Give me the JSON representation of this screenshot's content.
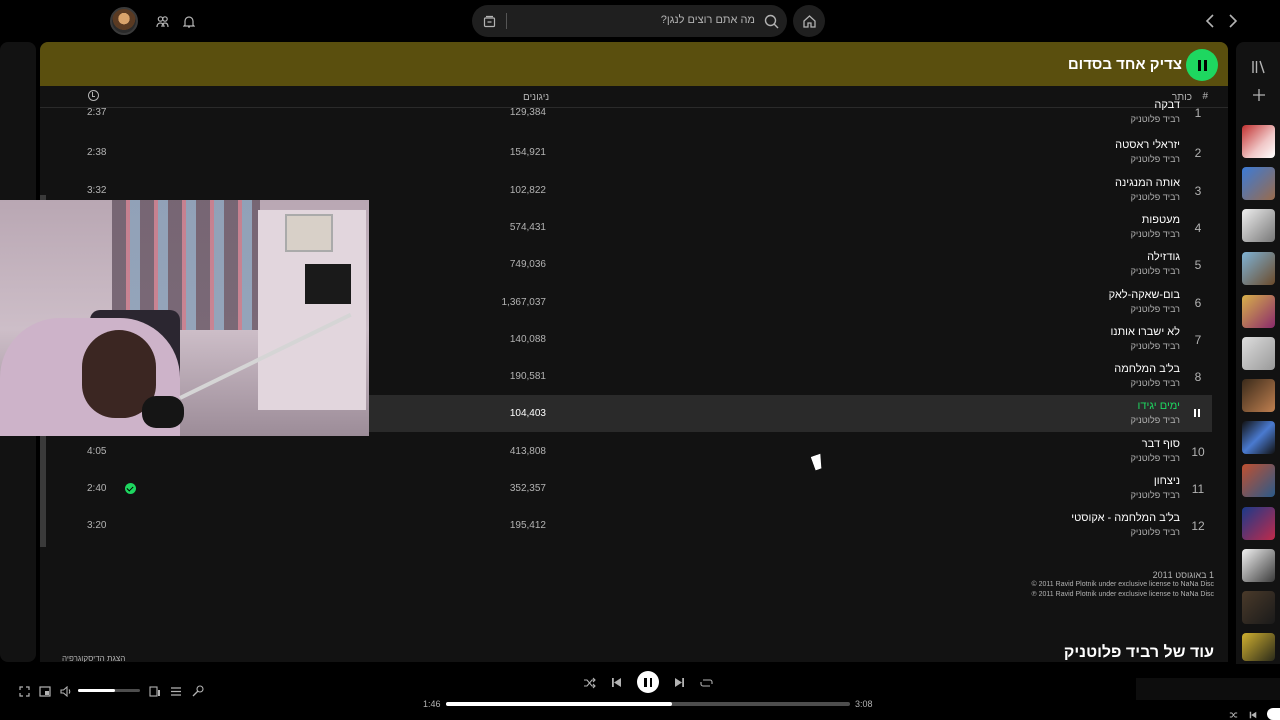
{
  "search": {
    "placeholder": "מה אתם רוצים לנגן?"
  },
  "album": {
    "title": "צדיק אחד בסדום"
  },
  "columns": {
    "number": "#",
    "title": "כותר",
    "plays": "ניגונים"
  },
  "tracks": [
    {
      "num": "1",
      "title": "דבקה",
      "artist": "רביד פלוטניק",
      "plays": "129,384",
      "duration": "2:37"
    },
    {
      "num": "2",
      "title": "יזראלי ראסטה",
      "artist": "רביד פלוטניק",
      "plays": "154,921",
      "duration": "2:38"
    },
    {
      "num": "3",
      "title": "אותה המנגינה",
      "artist": "רביד פלוטניק",
      "plays": "102,822",
      "duration": "3:32"
    },
    {
      "num": "4",
      "title": "מעטפות",
      "artist": "רביד פלוטניק",
      "plays": "574,431",
      "duration": ""
    },
    {
      "num": "5",
      "title": "גודזילה",
      "artist": "רביד פלוטניק",
      "plays": "749,036",
      "duration": ""
    },
    {
      "num": "6",
      "title": "בום-שאקה-לאק",
      "artist": "רביד פלוטניק",
      "plays": "1,367,037",
      "duration": ""
    },
    {
      "num": "7",
      "title": "לא ישברו אותנו",
      "artist": "רביד פלוטניק",
      "plays": "140,088",
      "duration": ""
    },
    {
      "num": "8",
      "title": "בל'ב המלחמה",
      "artist": "רביד פלוטניק",
      "plays": "190,581",
      "duration": ""
    },
    {
      "num": "",
      "title": "ימים יגידו",
      "artist": "רביד פלוטניק",
      "plays": "104,403",
      "duration": "",
      "active": true
    },
    {
      "num": "10",
      "title": "סוף דבר",
      "artist": "רביד פלוטניק",
      "plays": "413,808",
      "duration": "4:05"
    },
    {
      "num": "11",
      "title": "ניצחון",
      "artist": "רביד פלוטניק",
      "plays": "352,357",
      "duration": "2:40",
      "saved": true
    },
    {
      "num": "12",
      "title": "בל'ב המלחמה - אקוסטי",
      "artist": "רביד פלוטניק",
      "plays": "195,412",
      "duration": "3:20"
    }
  ],
  "footer": {
    "release_date": "1 באוגוסט 2011",
    "copyright_c": "© 2011 Ravid Plotnik under exclusive license to NaNa Disc",
    "copyright_p": "℗ 2011 Ravid Plotnik under exclusive license to NaNa Disc",
    "more_by": "עוד של רביד פלוטניק",
    "show_discography": "הצגת הדיסקוגרפיה"
  },
  "player": {
    "elapsed": "1:46",
    "total": "3:08",
    "progress_fraction": 0.56,
    "volume_fraction": 0.6
  },
  "colors": {
    "accent": "#1ed760",
    "header_bg": "#5a4f0e",
    "panel_bg": "#121212"
  }
}
